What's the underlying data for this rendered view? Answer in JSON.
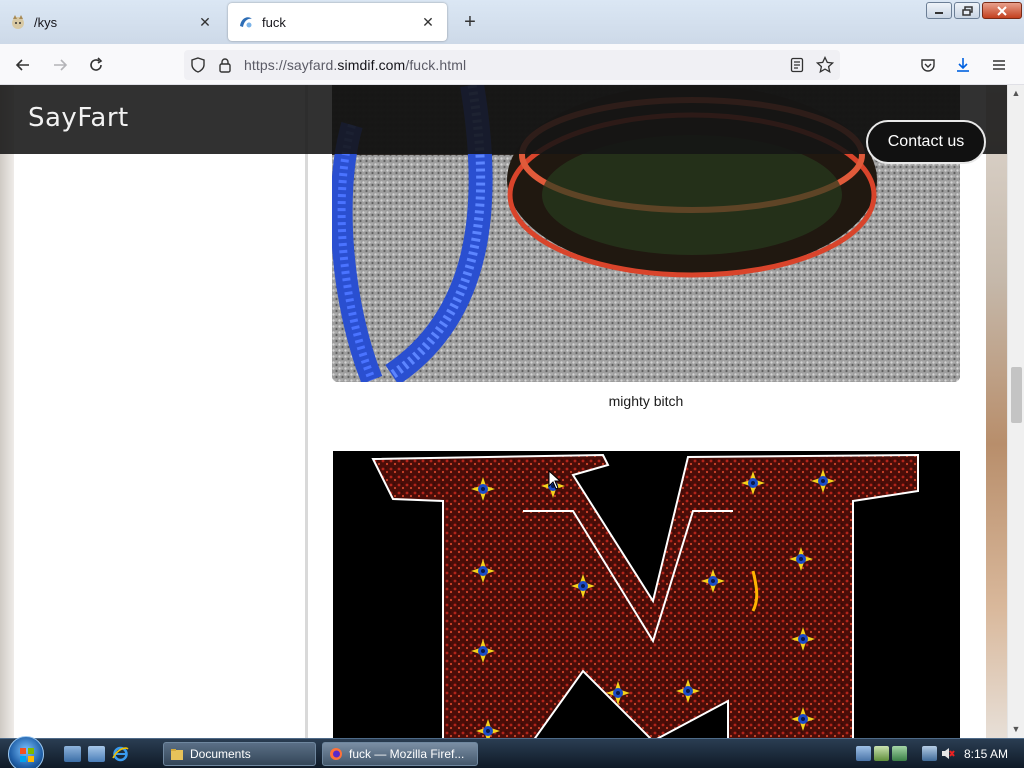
{
  "browser": {
    "tabs": [
      {
        "title": "/kys",
        "active": false
      },
      {
        "title": "fuck",
        "active": true
      }
    ],
    "url": {
      "prefix": "https://sayfard.",
      "domain": "simdif.com",
      "path": "/fuck.html"
    }
  },
  "site": {
    "brand": "SayFart",
    "contact_label": "Contact us",
    "caption": "mighty bitch"
  },
  "taskbar": {
    "items": [
      {
        "label": "Documents"
      },
      {
        "label": "fuck — Mozilla Firef..."
      }
    ],
    "clock": "8:15 AM"
  },
  "colors": {
    "header_bg": "#141414",
    "firefox_orange": "#ff7139",
    "download_blue": "#0061e0"
  }
}
